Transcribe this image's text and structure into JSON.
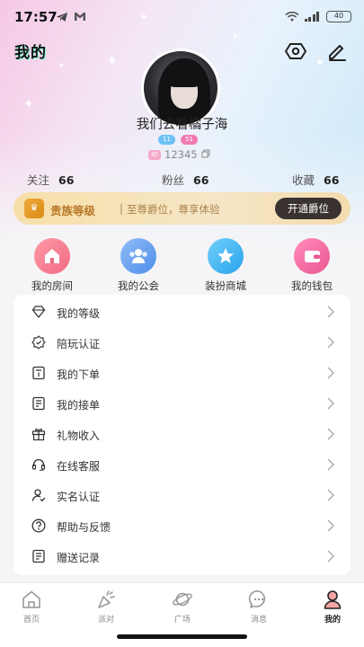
{
  "status_bar": {
    "time": "17:57",
    "battery": "40"
  },
  "header": {
    "title": "我的",
    "view_icon": "eye-icon",
    "edit_icon": "edit-icon"
  },
  "profile": {
    "nickname": "我们去看橘子海",
    "badge_level": "11",
    "badge_charm": "51",
    "uid_tag": "ID",
    "uid": "12345"
  },
  "stats": [
    {
      "label": "关注",
      "value": "66"
    },
    {
      "label": "粉丝",
      "value": "66"
    },
    {
      "label": "收藏",
      "value": "66"
    }
  ],
  "noble": {
    "title": "贵族等级",
    "separator": "|",
    "desc": "至尊爵位，尊享体验",
    "button": "开通爵位"
  },
  "quick_entries": [
    {
      "label": "我的房间",
      "icon": "home-icon",
      "color": "#f47a8d"
    },
    {
      "label": "我的公会",
      "icon": "group-icon",
      "color": "#5b9cf0"
    },
    {
      "label": "装扮商城",
      "icon": "star-icon",
      "color": "#3cb3f1"
    },
    {
      "label": "我的钱包",
      "icon": "wallet-icon",
      "color": "#f2679c"
    }
  ],
  "menu": [
    {
      "label": "我的等级",
      "icon": "diamond-icon"
    },
    {
      "label": "陪玩认证",
      "icon": "certificate-icon"
    },
    {
      "label": "我的下单",
      "icon": "order-icon"
    },
    {
      "label": "我的接单",
      "icon": "receive-order-icon"
    },
    {
      "label": "礼物收入",
      "icon": "gift-icon"
    },
    {
      "label": "在线客服",
      "icon": "headset-icon"
    },
    {
      "label": "实名认证",
      "icon": "user-verify-icon"
    },
    {
      "label": "帮助与反馈",
      "icon": "help-icon"
    },
    {
      "label": "赠送记录",
      "icon": "record-icon"
    }
  ],
  "tabs": [
    {
      "label": "首页",
      "icon": "home-tab-icon"
    },
    {
      "label": "派对",
      "icon": "party-icon"
    },
    {
      "label": "广场",
      "icon": "planet-icon"
    },
    {
      "label": "消息",
      "icon": "message-icon"
    },
    {
      "label": "我的",
      "icon": "profile-tab-icon",
      "active": true
    }
  ]
}
